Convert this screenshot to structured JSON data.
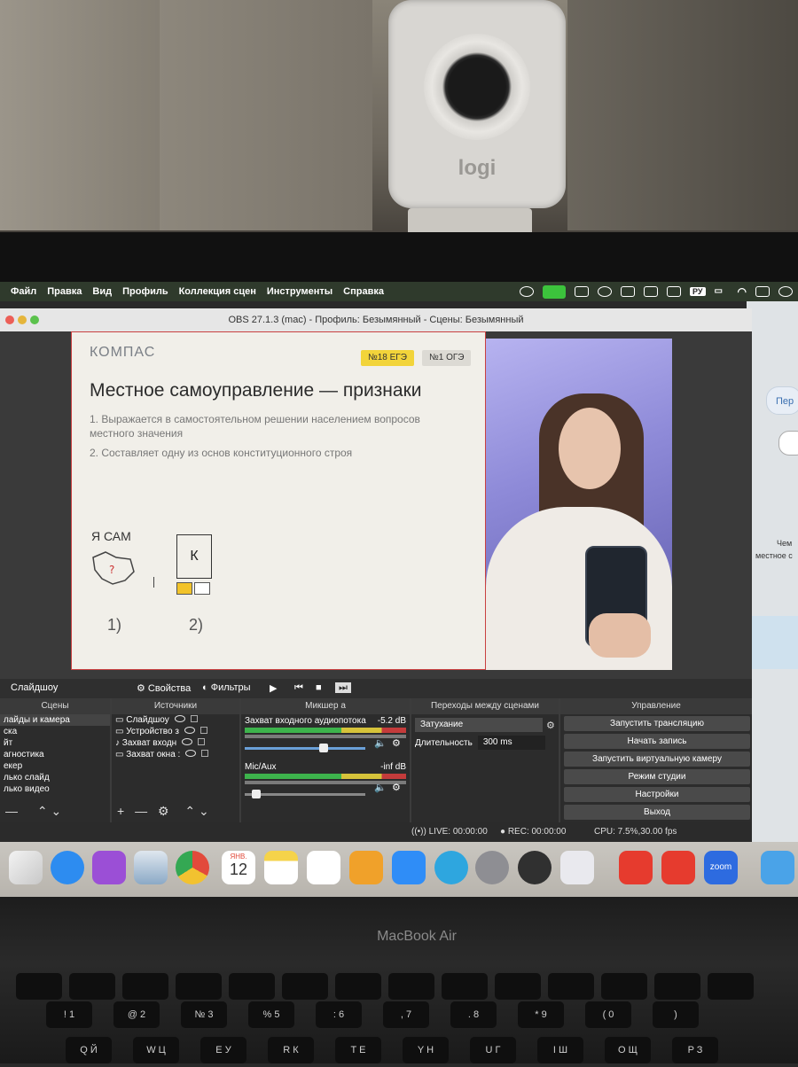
{
  "webcam": {
    "brand": "logi"
  },
  "menubar": {
    "items": [
      "Файл",
      "Правка",
      "Вид",
      "Профиль",
      "Коллекция сцен",
      "Инструменты",
      "Справка"
    ],
    "input_source": "РУ"
  },
  "obs": {
    "window_title": "OBS 27.1.3 (mac) - Профиль: Безымянный - Сцены: Безымянный",
    "slide": {
      "logo": "КОМПАС",
      "badge_1": "№18 ЕГЭ",
      "badge_2": "№1 ОГЭ",
      "title": "Местное самоуправление — признаки",
      "item_1": "1. Выражается в самостоятельном решении населением вопросов местного значения",
      "item_2": "2. Составляет одну из основ конституционного строя",
      "sketch_label": "Я САМ",
      "box_letter": "К",
      "num_1": "1)",
      "num_2": "2)"
    },
    "controls": {
      "selected_source": "Слайдшоу",
      "properties": "Свойства",
      "filters": "Фильтры"
    },
    "scenes": {
      "header": "Сцены",
      "items": [
        "лайды и камера",
        "ска",
        "йт",
        "агностика",
        "екер",
        "лько слайд",
        "лько видео"
      ]
    },
    "sources": {
      "header": "Источники",
      "items": [
        "Слайдшоу",
        "Устройство з",
        "Захват входн",
        "Захват окна :"
      ]
    },
    "mixer": {
      "header": "Микшер а",
      "ch1_name": "Захват входного аудиопотока",
      "ch1_db": "-5.2 dB",
      "ch1_level": 0.62,
      "ch2_name": "Mic/Aux",
      "ch2_db": "-inf dB",
      "ch2_level": 0.06
    },
    "transitions": {
      "header": "Переходы между сценами",
      "type": "Затухание",
      "duration_label": "Длительность",
      "duration_value": "300 ms"
    },
    "control": {
      "header": "Управление",
      "start_stream": "Запустить трансляцию",
      "start_record": "Начать запись",
      "start_vcam": "Запустить виртуальную камеру",
      "studio_mode": "Режим студии",
      "settings": "Настройки",
      "exit": "Выход"
    },
    "status": {
      "live": "LIVE: 00:00:00",
      "rec": "REC: 00:00:00",
      "cpu": "CPU: 7.5%,30.00 fps"
    }
  },
  "desktop_right": {
    "bubble": "Пер",
    "text_1": "Чем",
    "text_2": "местное с"
  },
  "dock": {
    "calendar_month": "ЯНВ.",
    "calendar_day": "12",
    "zoom_label": "zoom",
    "colors": {
      "safari": "#2d8cf0",
      "podcasts": "#9b4fd6",
      "chrome": "#e24a3b",
      "notes": "#f5d34a",
      "appstore": "#2f8df7",
      "telegram": "#2ea6df",
      "anydesk": "#e63b2e",
      "zoom": "#2d6be0",
      "finder": "#4aa3e8"
    }
  },
  "laptop": {
    "model": "MacBook Air"
  },
  "keyboard": {
    "row1": [
      "!",
      "@",
      "№",
      "%",
      ":",
      ",",
      ".",
      "*",
      "(",
      ")"
    ],
    "row1_nums": [
      "1",
      "2",
      "3",
      "5",
      "6",
      "7",
      "8",
      "9",
      "0"
    ],
    "row2": [
      "Й",
      "Ц",
      "У",
      "К",
      "Е",
      "Н",
      "Г",
      "Ш",
      "Щ",
      "З"
    ],
    "row2_latin": [
      "Q",
      "W",
      "E",
      "R",
      "T",
      "Y",
      "U",
      "I",
      "O",
      "P"
    ]
  }
}
